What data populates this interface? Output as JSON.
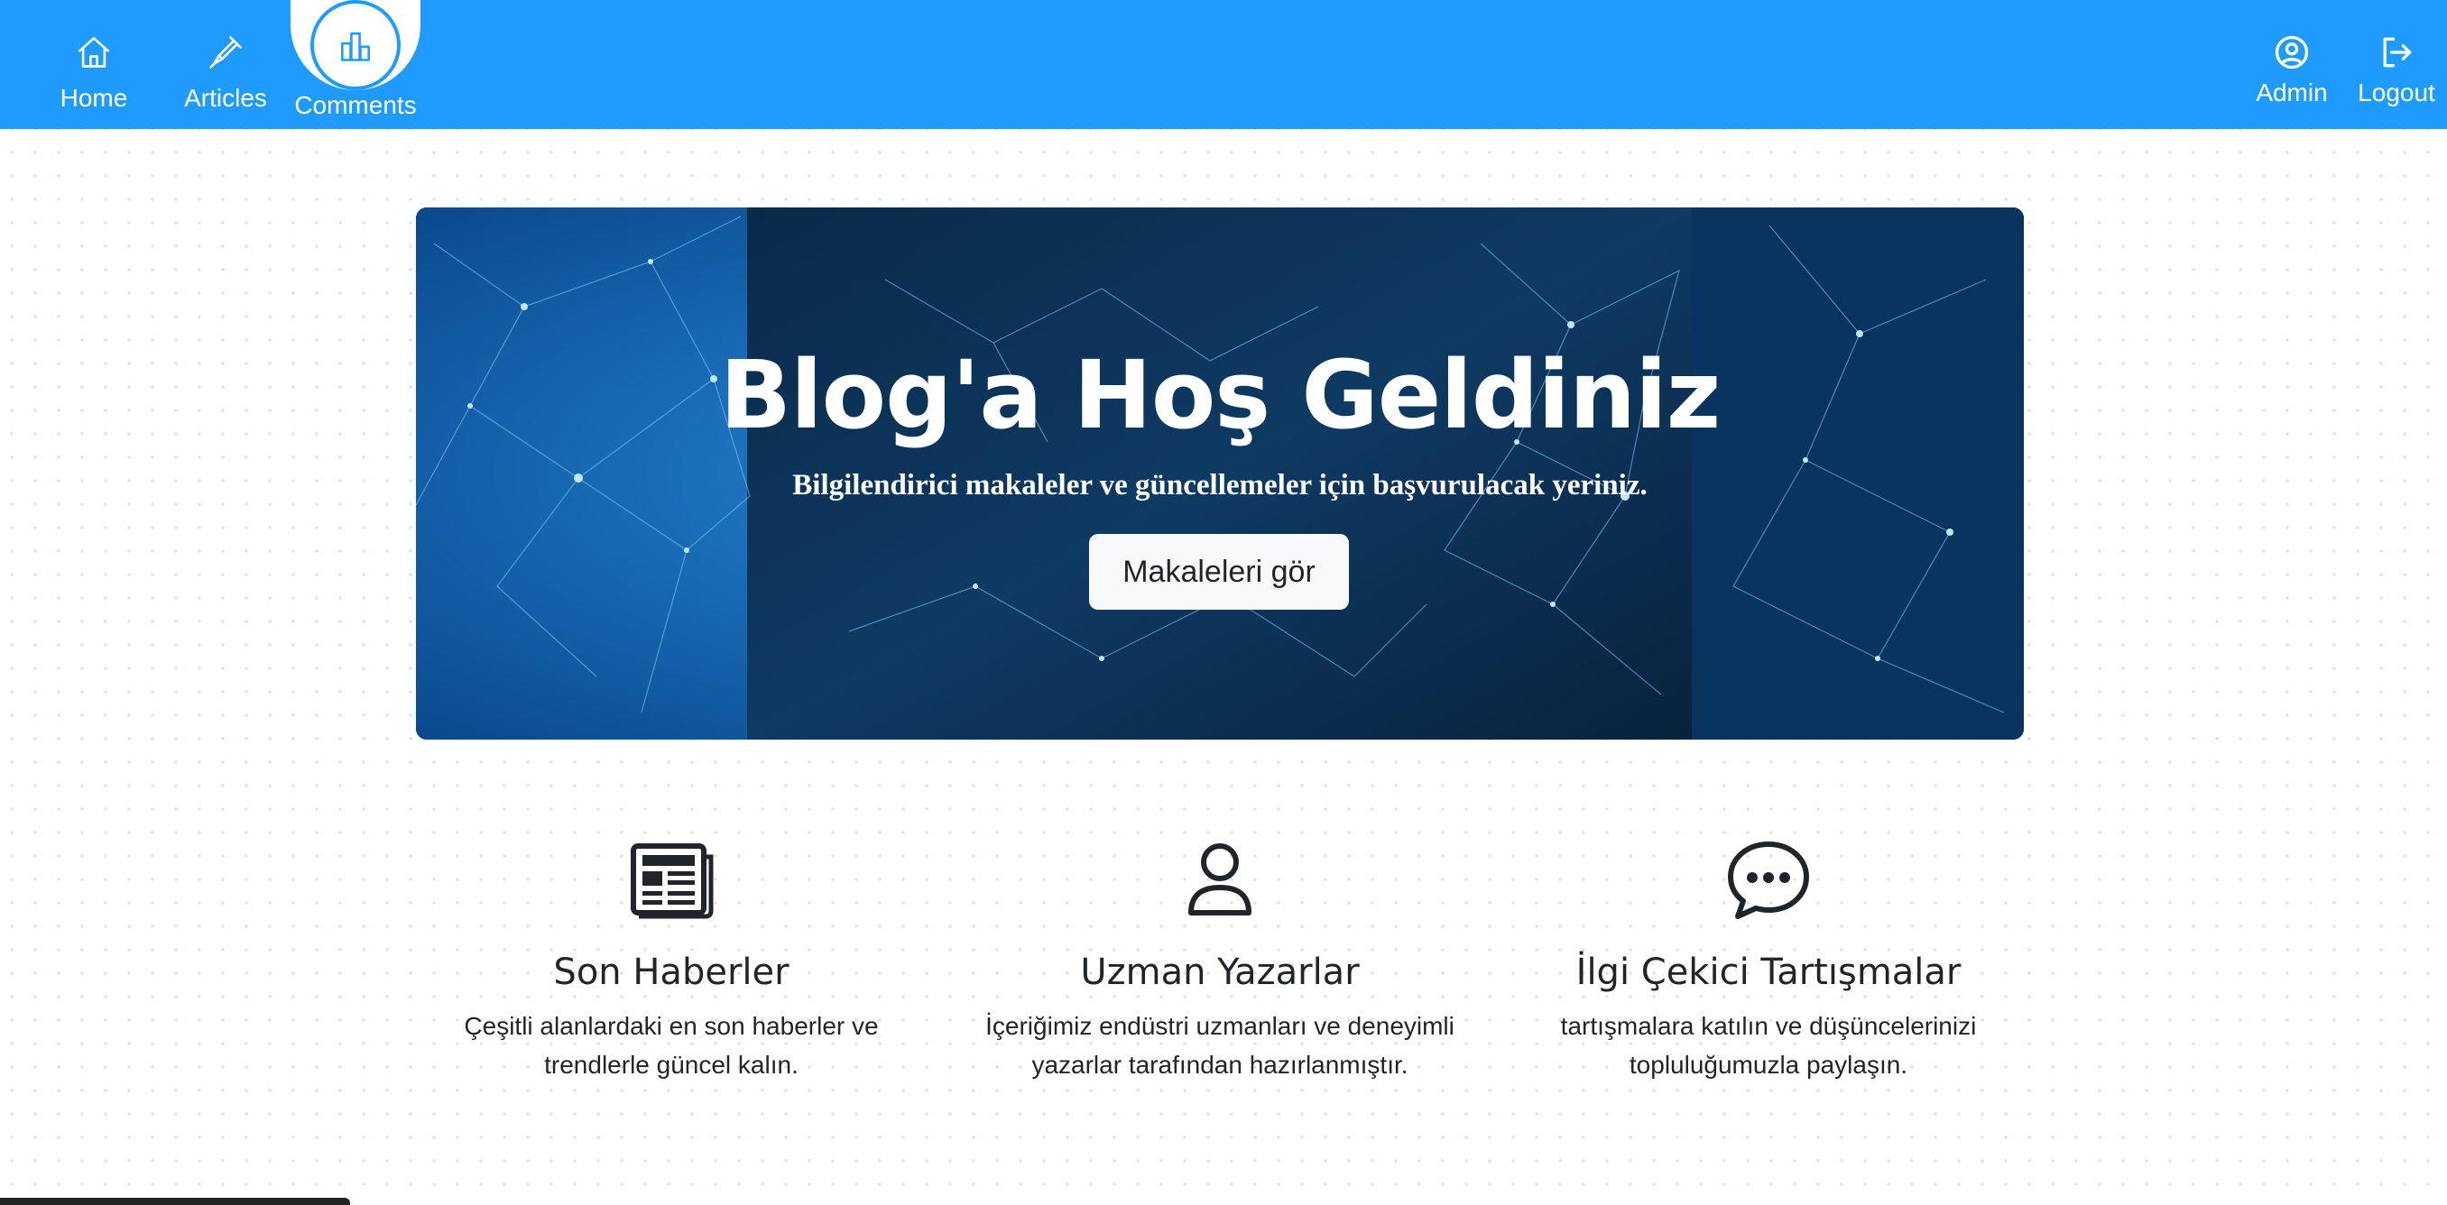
{
  "nav": {
    "items": [
      {
        "label": "Home",
        "icon": "home-icon"
      },
      {
        "label": "Articles",
        "icon": "pen-icon"
      },
      {
        "label": "Comments",
        "icon": "bar-chart-icon",
        "active": true
      }
    ],
    "right": [
      {
        "label": "Admin",
        "icon": "user-circle-icon"
      },
      {
        "label": "Logout",
        "icon": "logout-icon"
      }
    ],
    "bg_color": "#1f9bff"
  },
  "hero": {
    "title": "Blog'a Hoş Geldiniz",
    "subtitle": "Bilgilendirici makaleler ve güncellemeler için başvurulacak yeriniz.",
    "button_label": "Makaleleri gör"
  },
  "features": [
    {
      "icon": "newspaper-icon",
      "title": "Son Haberler",
      "text": "Çeşitli alanlardaki en son haberler ve trendlerle güncel kalın."
    },
    {
      "icon": "person-icon",
      "title": "Uzman Yazarlar",
      "text": "İçeriğimiz endüstri uzmanları ve deneyimli yazarlar tarafından hazırlanmıştır."
    },
    {
      "icon": "chat-bubble-icon",
      "title": "İlgi Çekici Tartışmalar",
      "text": "tartışmalara katılın ve düşüncelerinizi topluluğumuzla paylaşın."
    }
  ]
}
